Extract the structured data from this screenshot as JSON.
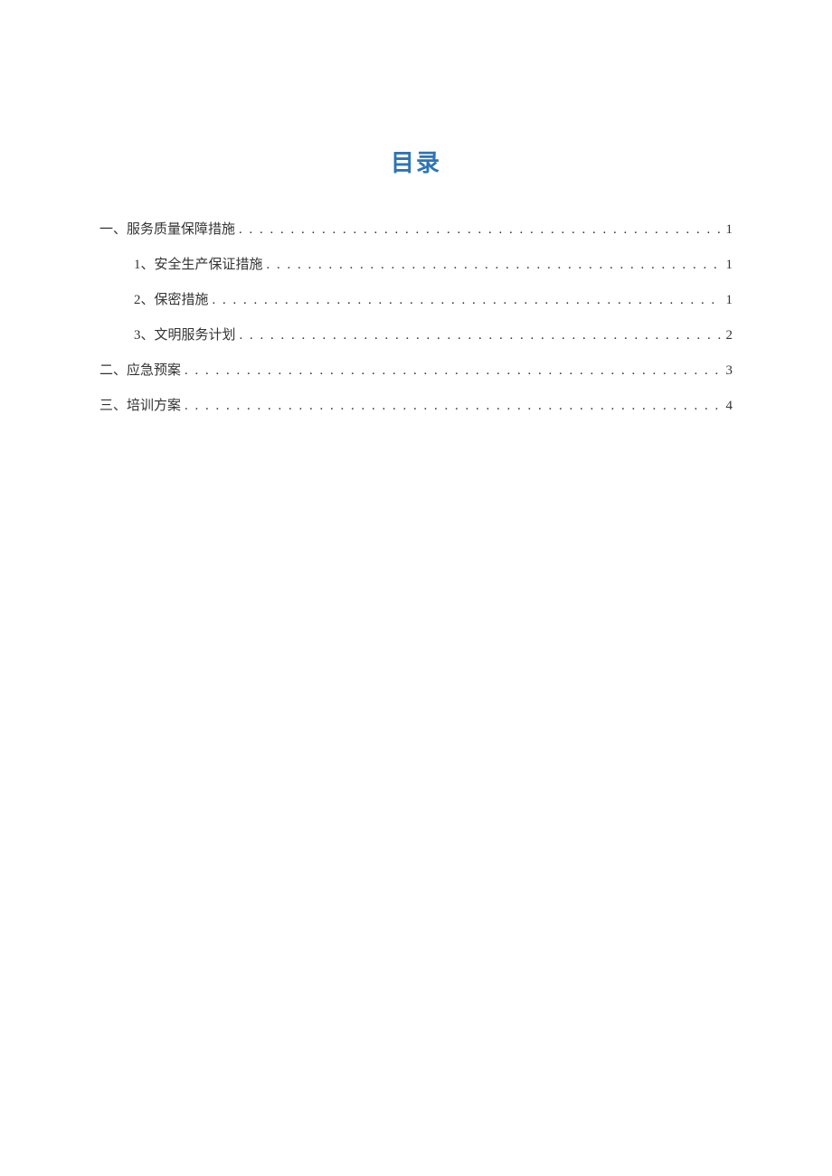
{
  "title": "目录",
  "toc": [
    {
      "level": 1,
      "label": "一、服务质量保障措施",
      "page": "1"
    },
    {
      "level": 2,
      "label": "1、安全生产保证措施",
      "page": "1"
    },
    {
      "level": 2,
      "label": "2、保密措施",
      "page": "1"
    },
    {
      "level": 2,
      "label": "3、文明服务计划",
      "page": "2"
    },
    {
      "level": 1,
      "label": "二、应急预案",
      "page": "3"
    },
    {
      "level": 1,
      "label": "三、培训方案",
      "page": "4"
    }
  ]
}
